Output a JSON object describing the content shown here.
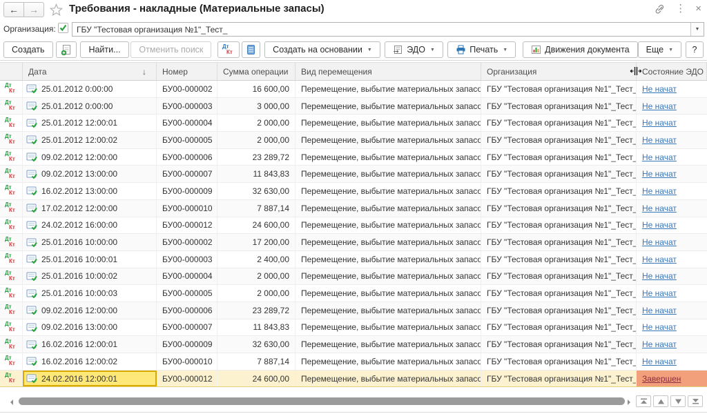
{
  "window": {
    "title": "Требования - накладные (Материальные запасы)",
    "back_glyph": "←",
    "forward_glyph": "→",
    "kebab_glyph": "⋮",
    "close_glyph": "×"
  },
  "filter": {
    "label": "Организация:",
    "checked": true,
    "value": "ГБУ \"Тестовая организация №1\"_Тест_"
  },
  "icons": {
    "dt": "Дт",
    "kt": "Кт",
    "caret": "▼",
    "sort_desc": "↓",
    "help": "?"
  },
  "toolbar": {
    "create": "Создать",
    "find": "Найти...",
    "cancel_search": "Отменить поиск",
    "create_based_on": "Создать на основании",
    "edo": "ЭДО",
    "print": "Печать",
    "movements": "Движения документа",
    "more": "Еще",
    "help": "?"
  },
  "table": {
    "columns": [
      "Дата",
      "Номер",
      "Сумма операции",
      "Вид перемещения",
      "Организация",
      "Состояние ЭДО"
    ],
    "sorted_column": "Дата",
    "rows": [
      {
        "date": "25.01.2012 0:00:00",
        "number": "БУ00-000002",
        "amount": "16 600,00",
        "kind": "Перемещение, выбытие материальных запасов",
        "org": "ГБУ \"Тестовая организация №1\"_Тест_",
        "status": "Не начат",
        "selected": false
      },
      {
        "date": "25.01.2012 0:00:00",
        "number": "БУ00-000003",
        "amount": "3 000,00",
        "kind": "Перемещение, выбытие материальных запасов",
        "org": "ГБУ \"Тестовая организация №1\"_Тест_",
        "status": "Не начат",
        "selected": false
      },
      {
        "date": "25.01.2012 12:00:01",
        "number": "БУ00-000004",
        "amount": "2 000,00",
        "kind": "Перемещение, выбытие материальных запасов",
        "org": "ГБУ \"Тестовая организация №1\"_Тест_",
        "status": "Не начат",
        "selected": false
      },
      {
        "date": "25.01.2012 12:00:02",
        "number": "БУ00-000005",
        "amount": "2 000,00",
        "kind": "Перемещение, выбытие материальных запасов",
        "org": "ГБУ \"Тестовая организация №1\"_Тест_",
        "status": "Не начат",
        "selected": false
      },
      {
        "date": "09.02.2012 12:00:00",
        "number": "БУ00-000006",
        "amount": "23 289,72",
        "kind": "Перемещение, выбытие материальных запасов",
        "org": "ГБУ \"Тестовая организация №1\"_Тест_",
        "status": "Не начат",
        "selected": false
      },
      {
        "date": "09.02.2012 13:00:00",
        "number": "БУ00-000007",
        "amount": "11 843,83",
        "kind": "Перемещение, выбытие материальных запасов",
        "org": "ГБУ \"Тестовая организация №1\"_Тест_",
        "status": "Не начат",
        "selected": false
      },
      {
        "date": "16.02.2012 13:00:00",
        "number": "БУ00-000009",
        "amount": "32 630,00",
        "kind": "Перемещение, выбытие материальных запасов",
        "org": "ГБУ \"Тестовая организация №1\"_Тест_",
        "status": "Не начат",
        "selected": false
      },
      {
        "date": "17.02.2012 12:00:00",
        "number": "БУ00-000010",
        "amount": "7 887,14",
        "kind": "Перемещение, выбытие материальных запасов",
        "org": "ГБУ \"Тестовая организация №1\"_Тест_",
        "status": "Не начат",
        "selected": false
      },
      {
        "date": "24.02.2012 16:00:00",
        "number": "БУ00-000012",
        "amount": "24 600,00",
        "kind": "Перемещение, выбытие материальных запасов",
        "org": "ГБУ \"Тестовая организация №1\"_Тест_",
        "status": "Не начат",
        "selected": false
      },
      {
        "date": "25.01.2016 10:00:00",
        "number": "БУ00-000002",
        "amount": "17 200,00",
        "kind": "Перемещение, выбытие материальных запасов",
        "org": "ГБУ \"Тестовая организация №1\"_Тест_",
        "status": "Не начат",
        "selected": false
      },
      {
        "date": "25.01.2016 10:00:01",
        "number": "БУ00-000003",
        "amount": "2 400,00",
        "kind": "Перемещение, выбытие материальных запасов",
        "org": "ГБУ \"Тестовая организация №1\"_Тест_",
        "status": "Не начат",
        "selected": false
      },
      {
        "date": "25.01.2016 10:00:02",
        "number": "БУ00-000004",
        "amount": "2 000,00",
        "kind": "Перемещение, выбытие материальных запасов",
        "org": "ГБУ \"Тестовая организация №1\"_Тест_",
        "status": "Не начат",
        "selected": false
      },
      {
        "date": "25.01.2016 10:00:03",
        "number": "БУ00-000005",
        "amount": "2 000,00",
        "kind": "Перемещение, выбытие материальных запасов",
        "org": "ГБУ \"Тестовая организация №1\"_Тест_",
        "status": "Не начат",
        "selected": false
      },
      {
        "date": "09.02.2016 12:00:00",
        "number": "БУ00-000006",
        "amount": "23 289,72",
        "kind": "Перемещение, выбытие материальных запасов",
        "org": "ГБУ \"Тестовая организация №1\"_Тест_",
        "status": "Не начат",
        "selected": false
      },
      {
        "date": "09.02.2016 13:00:00",
        "number": "БУ00-000007",
        "amount": "11 843,83",
        "kind": "Перемещение, выбытие материальных запасов",
        "org": "ГБУ \"Тестовая организация №1\"_Тест_",
        "status": "Не начат",
        "selected": false
      },
      {
        "date": "16.02.2016 12:00:01",
        "number": "БУ00-000009",
        "amount": "32 630,00",
        "kind": "Перемещение, выбытие материальных запасов",
        "org": "ГБУ \"Тестовая организация №1\"_Тест_",
        "status": "Не начат",
        "selected": false
      },
      {
        "date": "16.02.2016 12:00:02",
        "number": "БУ00-000010",
        "amount": "7 887,14",
        "kind": "Перемещение, выбытие материальных запасов",
        "org": "ГБУ \"Тестовая организация №1\"_Тест_",
        "status": "Не начат",
        "selected": false
      },
      {
        "date": "24.02.2016 12:00:01",
        "number": "БУ00-000012",
        "amount": "24 600,00",
        "kind": "Перемещение, выбытие материальных запасов",
        "org": "ГБУ \"Тестовая организация №1\"_Тест_",
        "status": "Завершен",
        "selected": true
      }
    ]
  },
  "colors": {
    "link": "#3677bc",
    "selected_row_bg": "#fcf2d0",
    "selected_cell_bg": "#ffe87a",
    "selected_cell_border": "#d9a900",
    "finished_bg": "#f2a07c",
    "finished_text": "#8b2e3f",
    "dt_green": "#1f9e3d",
    "dt_blue": "#2e75b6",
    "kt_red": "#d23b3b"
  }
}
